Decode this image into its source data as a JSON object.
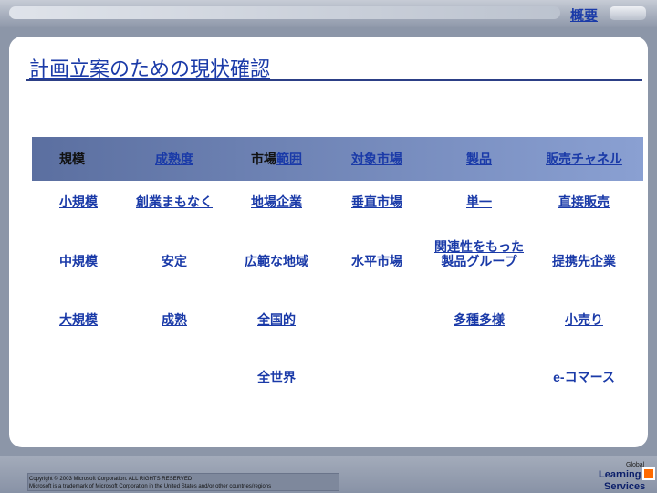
{
  "nav": {
    "link_label": "概要"
  },
  "title": "計画立案のための現状確認",
  "table": {
    "headers": [
      {
        "pre": "規模",
        "hl": ""
      },
      {
        "pre": "",
        "hl": "成熟度"
      },
      {
        "pre": "市場",
        "hl": "範囲"
      },
      {
        "pre": "",
        "hl": "対象市場"
      },
      {
        "pre": "",
        "hl": "製品"
      },
      {
        "pre": "",
        "hl": "販売チャネル"
      }
    ],
    "rows": [
      [
        "小規模",
        "創業まもなく",
        "地場企業",
        "垂直市場",
        "単一",
        "直接販売"
      ],
      [
        "中規模",
        "安定",
        "広範な地域",
        "水平市場",
        "関連性をもった製品グループ",
        "提携先企業"
      ],
      [
        "大規模",
        "成熟",
        "全国的",
        "",
        "多種多様",
        "小売り"
      ],
      [
        "",
        "",
        "全世界",
        "",
        "",
        "e-コマース"
      ]
    ]
  },
  "footer": {
    "line1": "Copyright © 2003 Microsoft Corporation. ALL RIGHTS RESERVED",
    "line2": "Microsoft is a trademark of Microsoft Corporation in the United States and/or other countries/regions",
    "logo_top": "Global",
    "logo_mid": "Learning",
    "logo_bot": "Services"
  }
}
